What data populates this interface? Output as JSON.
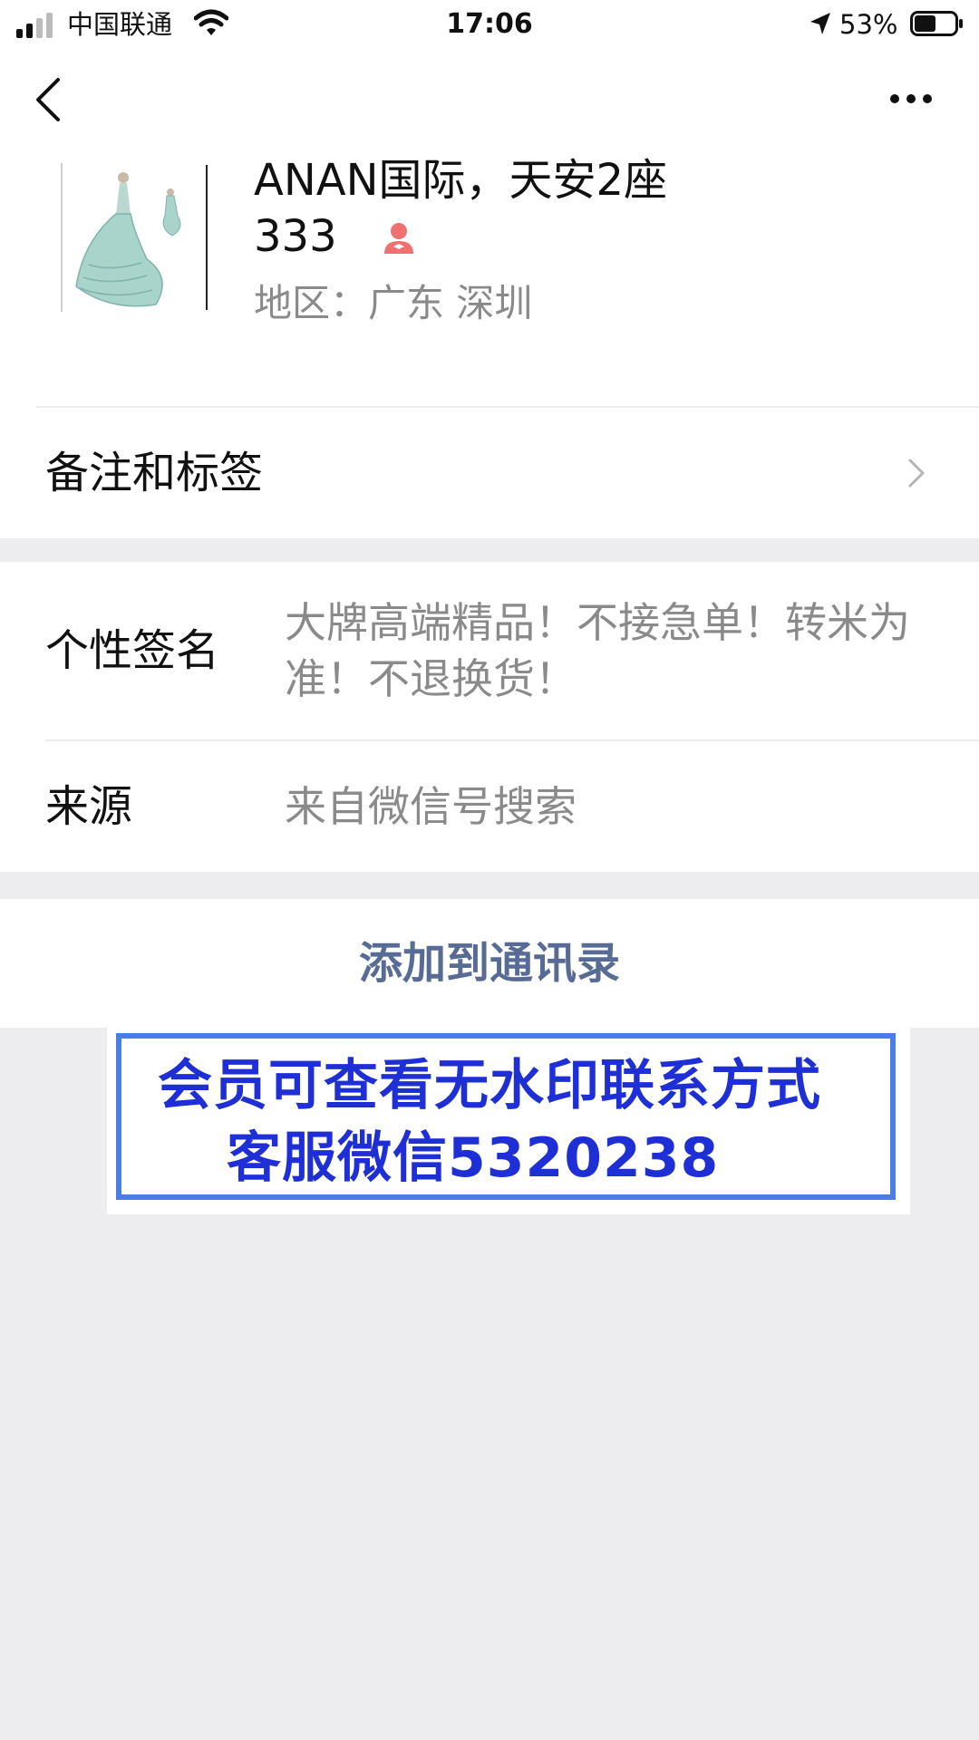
{
  "status_bar": {
    "carrier": "中国联通",
    "time": "17:06",
    "battery_percent": "53%",
    "battery_level": 0.53
  },
  "profile": {
    "name_line1": "ANAN国际，天安2座",
    "name_line2": "333",
    "region": "地区：广东 深圳",
    "gender_icon": "female-icon",
    "gender_color": "#f07070"
  },
  "remark_row": {
    "label": "备注和标签"
  },
  "signature": {
    "label": "个性签名",
    "value": "大牌高端精品！不接急单！转米为准！不退换货！"
  },
  "source": {
    "label": "来源",
    "value": "来自微信号搜索"
  },
  "actions": {
    "add_contact": "添加到通讯录",
    "link_color": "#576b95"
  },
  "watermark": {
    "line1": "会员可查看无水印联系方式",
    "line2": "客服微信5320238",
    "text_color": "#1f2fd6",
    "border_color": "#4a7ee6"
  }
}
